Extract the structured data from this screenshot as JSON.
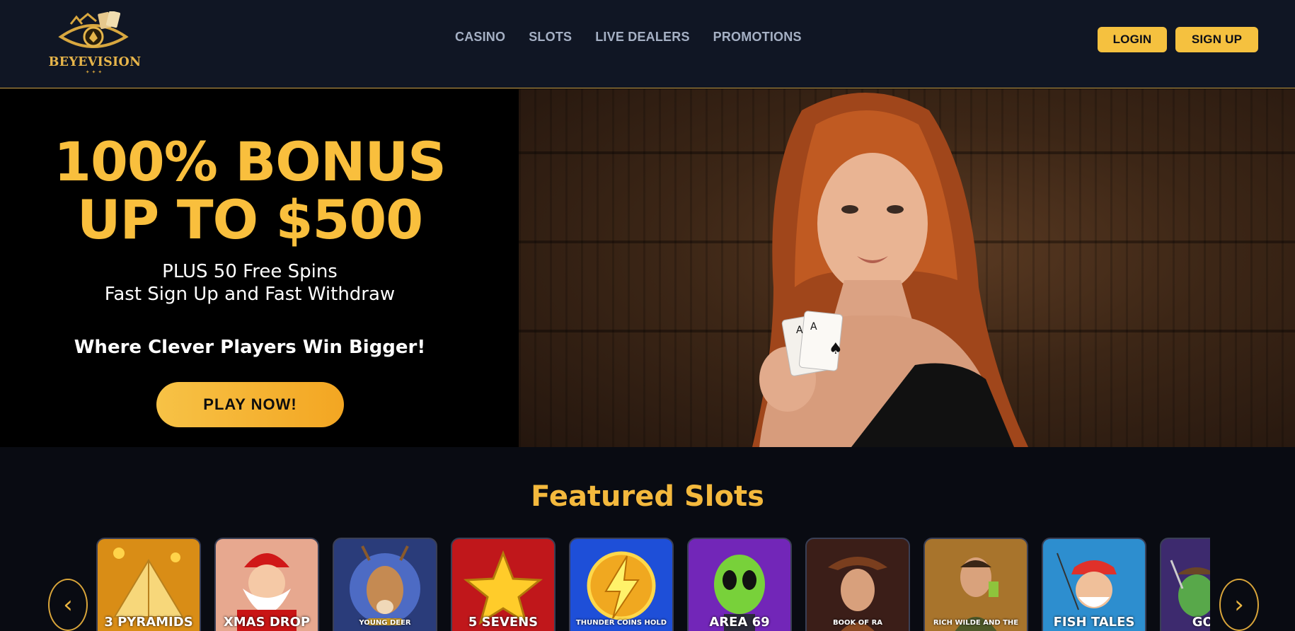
{
  "brand": {
    "name": "BEYEVISION"
  },
  "nav": {
    "items": [
      "CASINO",
      "SLOTS",
      "LIVE DEALERS",
      "PROMOTIONS"
    ]
  },
  "auth": {
    "login_label": "LOGIN",
    "signup_label": "SIGN UP"
  },
  "hero": {
    "headline_line1": "100% BONUS",
    "headline_line2": "UP TO $500",
    "sub_line1": "PLUS 50 Free Spins",
    "sub_line2": "Fast Sign Up and Fast Withdraw",
    "tagline": "Where Clever Players Win Bigger!",
    "cta_label": "PLAY NOW!"
  },
  "featured": {
    "title": "Featured Slots",
    "prev_arrow": "‹",
    "next_arrow": "›",
    "slots": [
      {
        "label": "3 PYRAMIDS",
        "icon": "pyramid-icon",
        "bg": "#d98d16"
      },
      {
        "label": "XMAS DROP",
        "icon": "santa-icon",
        "bg": "#e7a88f"
      },
      {
        "label": "YOUNG DEER",
        "icon": "deer-icon",
        "bg": "#2a3c7a"
      },
      {
        "label": "5 SEVENS",
        "icon": "star-icon",
        "bg": "#c0171b"
      },
      {
        "label": "THUNDER COINS HOLD",
        "icon": "lightning-icon",
        "bg": "#1e4fd8"
      },
      {
        "label": "AREA 69",
        "icon": "alien-icon",
        "bg": "#7226b8"
      },
      {
        "label": "BOOK OF RA",
        "icon": "explorer-icon",
        "bg": "#3b1e18"
      },
      {
        "label": "RICH WILDE AND THE",
        "icon": "adventurer-icon",
        "bg": "#a8742c"
      },
      {
        "label": "FISH TALES",
        "icon": "fisherman-icon",
        "bg": "#2d8ecf"
      },
      {
        "label": "GOLD",
        "icon": "goblin-icon",
        "bg": "#3d2a6e"
      }
    ]
  },
  "colors": {
    "accent": "#f5c13f",
    "header_bg": "#101624",
    "page_bg": "#090b12"
  }
}
